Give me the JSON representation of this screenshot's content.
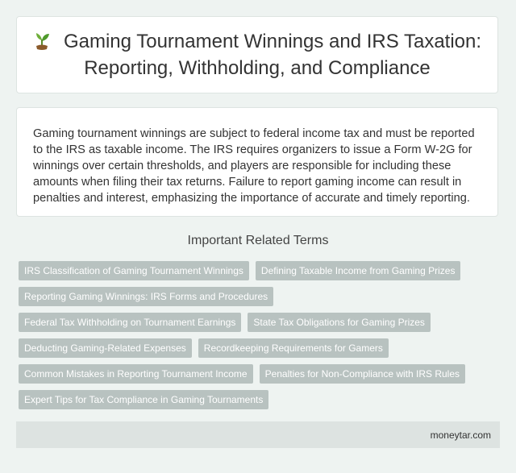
{
  "header": {
    "title": "Gaming Tournament Winnings and IRS Taxation: Reporting, Withholding, and Compliance",
    "icon": "sprout-icon"
  },
  "description": {
    "text": "Gaming tournament winnings are subject to federal income tax and must be reported to the IRS as taxable income. The IRS requires organizers to issue a Form W-2G for winnings over certain thresholds, and players are responsible for including these amounts when filing their tax returns. Failure to report gaming income can result in penalties and interest, emphasizing the importance of accurate and timely reporting."
  },
  "related": {
    "heading": "Important Related Terms",
    "terms": [
      "IRS Classification of Gaming Tournament Winnings",
      "Defining Taxable Income from Gaming Prizes",
      "Reporting Gaming Winnings: IRS Forms and Procedures",
      "Federal Tax Withholding on Tournament Earnings",
      "State Tax Obligations for Gaming Prizes",
      "Deducting Gaming-Related Expenses",
      "Recordkeeping Requirements for Gamers",
      "Common Mistakes in Reporting Tournament Income",
      "Penalties for Non-Compliance with IRS Rules",
      "Expert Tips for Tax Compliance in Gaming Tournaments"
    ]
  },
  "footer": {
    "site": "moneytar.com"
  },
  "colors": {
    "background": "#eef3f1",
    "card": "#ffffff",
    "tag": "#b8c2c0",
    "footer": "#dde3e1"
  }
}
